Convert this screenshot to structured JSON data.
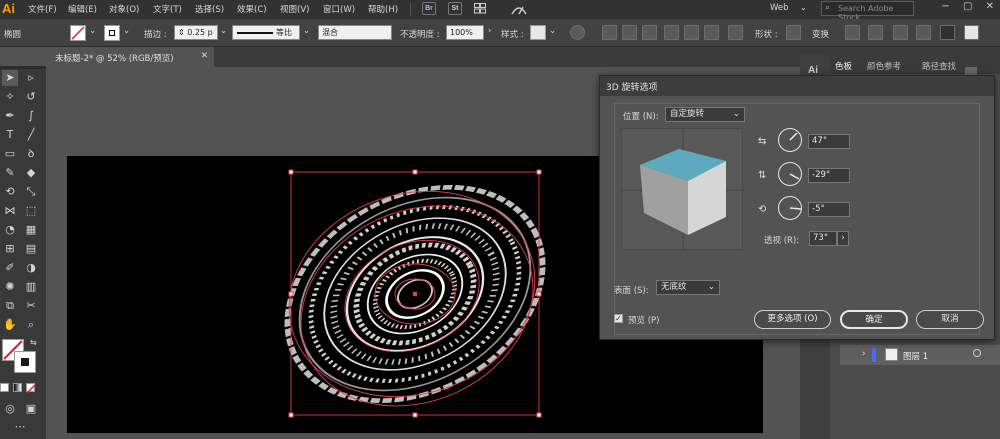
{
  "app": {
    "logo": "Ai"
  },
  "menu": [
    "文件(F)",
    "编辑(E)",
    "对象(O)",
    "文字(T)",
    "选择(S)",
    "效果(C)",
    "视图(V)",
    "窗口(W)",
    "帮助(H)"
  ],
  "menubar_buttons": [
    "Br",
    "St"
  ],
  "workspace": "Web",
  "search_placeholder": "Search Adobe Stock",
  "control_bar": {
    "selection_type": "椭圆",
    "stroke_label": "描边 :",
    "stroke_value": "0.25 p",
    "stroke_profile": "等比",
    "blend_mode": "混合",
    "opacity_label": "不透明度 :",
    "opacity_value": "100%",
    "style_label": "样式 :",
    "shape_label": "形状 :",
    "transform_label": "变换"
  },
  "document_tab": "未标题-2* @ 52% (RGB/预览)",
  "right_panel": {
    "tabs": [
      "色板",
      "颜色参考",
      "路径查找"
    ],
    "layer_name": "图层 1"
  },
  "dialog": {
    "title": "3D 旋转选项",
    "position_label": "位置 (N):",
    "position_value": "自定旋转",
    "rotation_x": "47°",
    "rotation_y": "-29°",
    "rotation_z": "-5°",
    "perspective_label": "透视 (R):",
    "perspective_value": "73°",
    "surface_label": "表面 (S):",
    "surface_value": "无底纹",
    "preview_label": "预览 (P)",
    "preview_checked": true,
    "more_options": "更多选项 (O)",
    "ok": "确定",
    "cancel": "取消"
  },
  "colors": {
    "cube_top": "#5da9bd",
    "cube_left": "#a0a0a0",
    "cube_right": "#d6d6d6",
    "path_red": "#e0404a",
    "logo_orange": "#ff9a00"
  }
}
